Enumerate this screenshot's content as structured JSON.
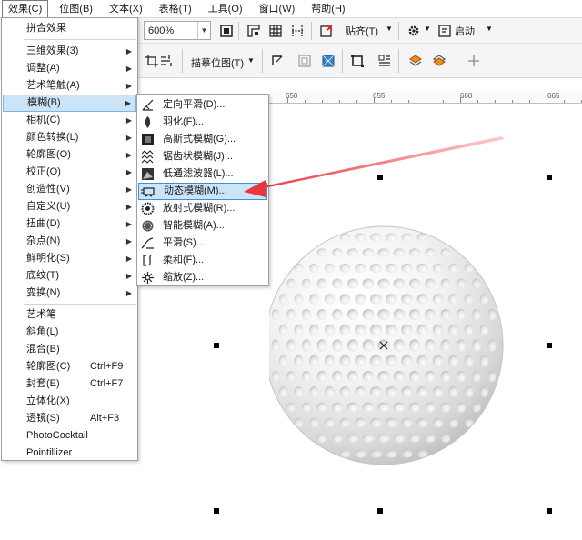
{
  "menubar": {
    "items": [
      {
        "label": "效果(C)"
      },
      {
        "label": "位图(B)"
      },
      {
        "label": "文本(X)"
      },
      {
        "label": "表格(T)"
      },
      {
        "label": "工具(O)"
      },
      {
        "label": "窗口(W)"
      },
      {
        "label": "帮助(H)"
      }
    ]
  },
  "toolbar": {
    "zoom_value": "600%",
    "align_label": "贴齐(T)",
    "launch_label": "启动",
    "trace_bitmap_label": "描摹位图(T)"
  },
  "ruler": {
    "labels": [
      "650",
      "655",
      "660",
      "665"
    ]
  },
  "effects_menu": {
    "items": [
      {
        "label": "拼合效果"
      },
      {
        "label": "三维效果(3)"
      },
      {
        "label": "调整(A)"
      },
      {
        "label": "艺术笔触(A)"
      },
      {
        "label": "模糊(B)"
      },
      {
        "label": "相机(C)"
      },
      {
        "label": "颜色转换(L)"
      },
      {
        "label": "轮廓图(O)"
      },
      {
        "label": "校正(O)"
      },
      {
        "label": "创造性(V)"
      },
      {
        "label": "自定义(U)"
      },
      {
        "label": "扭曲(D)"
      },
      {
        "label": "杂点(N)"
      },
      {
        "label": "鲜明化(S)"
      },
      {
        "label": "底纹(T)"
      },
      {
        "label": "变换(N)"
      },
      {
        "label": "艺术笔"
      },
      {
        "label": "斜角(L)"
      },
      {
        "label": "混合(B)"
      },
      {
        "label": "轮廓图(C)",
        "shortcut": "Ctrl+F9"
      },
      {
        "label": "封套(E)",
        "shortcut": "Ctrl+F7"
      },
      {
        "label": "立体化(X)"
      },
      {
        "label": "透镜(S)",
        "shortcut": "Alt+F3"
      },
      {
        "label": "PhotoCocktail"
      },
      {
        "label": "Pointillizer"
      }
    ]
  },
  "blur_submenu": {
    "items": [
      {
        "label": "定向平滑(D)...",
        "icon": "directional-smooth-icon"
      },
      {
        "label": "羽化(F)...",
        "icon": "feather-icon"
      },
      {
        "label": "高斯式模糊(G)...",
        "icon": "gaussian-blur-icon"
      },
      {
        "label": "锯齿状模糊(J)...",
        "icon": "jaggy-despeckle-icon"
      },
      {
        "label": "低通滤波器(L)...",
        "icon": "low-pass-icon"
      },
      {
        "label": "动态模糊(M)...",
        "icon": "motion-blur-icon"
      },
      {
        "label": "放射式模糊(R)...",
        "icon": "radial-blur-icon"
      },
      {
        "label": "智能模糊(A)...",
        "icon": "smart-blur-icon"
      },
      {
        "label": "平滑(S)...",
        "icon": "smooth-icon"
      },
      {
        "label": "柔和(F)...",
        "icon": "soften-icon"
      },
      {
        "label": "缩放(Z)...",
        "icon": "zoom-blur-icon"
      }
    ]
  },
  "colors": {
    "highlight": "#cce4f7",
    "highlight_border": "#3c91d6",
    "annotation_arrow": "#e8383d"
  }
}
